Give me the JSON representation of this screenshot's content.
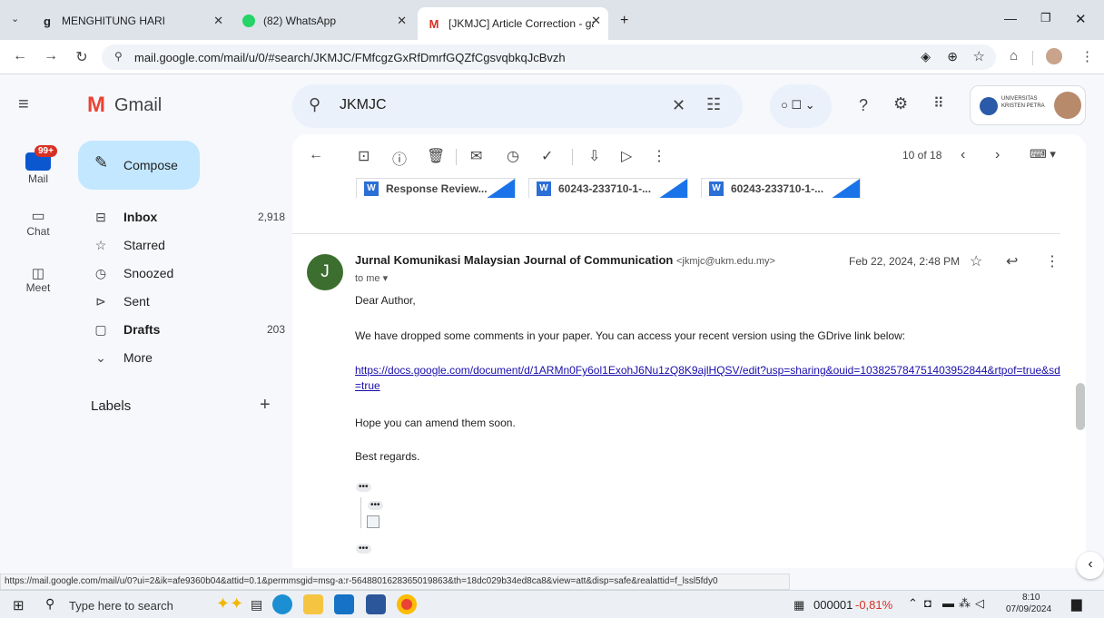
{
  "browser": {
    "tabs": [
      {
        "title": "MENGHITUNG HARI",
        "active": false
      },
      {
        "title": "(82) WhatsApp",
        "active": false
      },
      {
        "title": "[JKMJC] Article Correction - gat",
        "active": true
      }
    ],
    "url": "mail.google.com/mail/u/0/#search/JKMJC/FMfcgzGxRfDmrfGQZfCgsvqbkqJcBvzh",
    "status_url": "https://mail.google.com/mail/u/0?ui=2&ik=afe9360b04&attid=0.1&permmsgid=msg-a:r-5648801628365019863&th=18dc029b34ed8ca8&view=att&disp=safe&realattid=f_lssl5fdy0"
  },
  "gmail": {
    "app_name": "Gmail",
    "search_query": "JKMJC",
    "account_org": "UNIVERSITAS KRISTEN PETRA",
    "rail": [
      {
        "label": "Mail",
        "badge": "99+"
      },
      {
        "label": "Chat"
      },
      {
        "label": "Meet"
      }
    ],
    "compose_label": "Compose",
    "nav": [
      {
        "label": "Inbox",
        "count": "2,918",
        "bold": true
      },
      {
        "label": "Starred",
        "count": ""
      },
      {
        "label": "Snoozed",
        "count": ""
      },
      {
        "label": "Sent",
        "count": ""
      },
      {
        "label": "Drafts",
        "count": "203",
        "bold": true
      },
      {
        "label": "More",
        "count": ""
      }
    ],
    "labels_heading": "Labels",
    "pagination": "10 of 18",
    "attachments": [
      "Response Review...",
      "60243-233710-1-...",
      "60243-233710-1-..."
    ],
    "message": {
      "avatar_letter": "J",
      "sender": "Jurnal Komunikasi Malaysian Journal of Communication",
      "sender_email": "<jkmjc@ukm.edu.my>",
      "date": "Feb 22, 2024, 2:48 PM",
      "to": "to me",
      "greeting": "Dear Author,",
      "body1": "We have dropped some comments in your paper. You can access your recent version using the GDrive link below:",
      "link": "https://docs.google.com/document/d/1ARMn0Fy6ol1ExohJ6Nu1zQ8K9ajlHQSV/edit?usp=sharing&ouid=103825784751403952844&rtpof=true&sd=true",
      "body2": "Hope you can amend them soon.",
      "closing": "Best regards."
    }
  },
  "taskbar": {
    "search_placeholder": "Type here to search",
    "ticker_code": "000001",
    "ticker_change": "-0,81%",
    "time": "8:10",
    "date": "07/09/2024",
    "colors": {
      "ticker_negative": "#d93025"
    }
  }
}
